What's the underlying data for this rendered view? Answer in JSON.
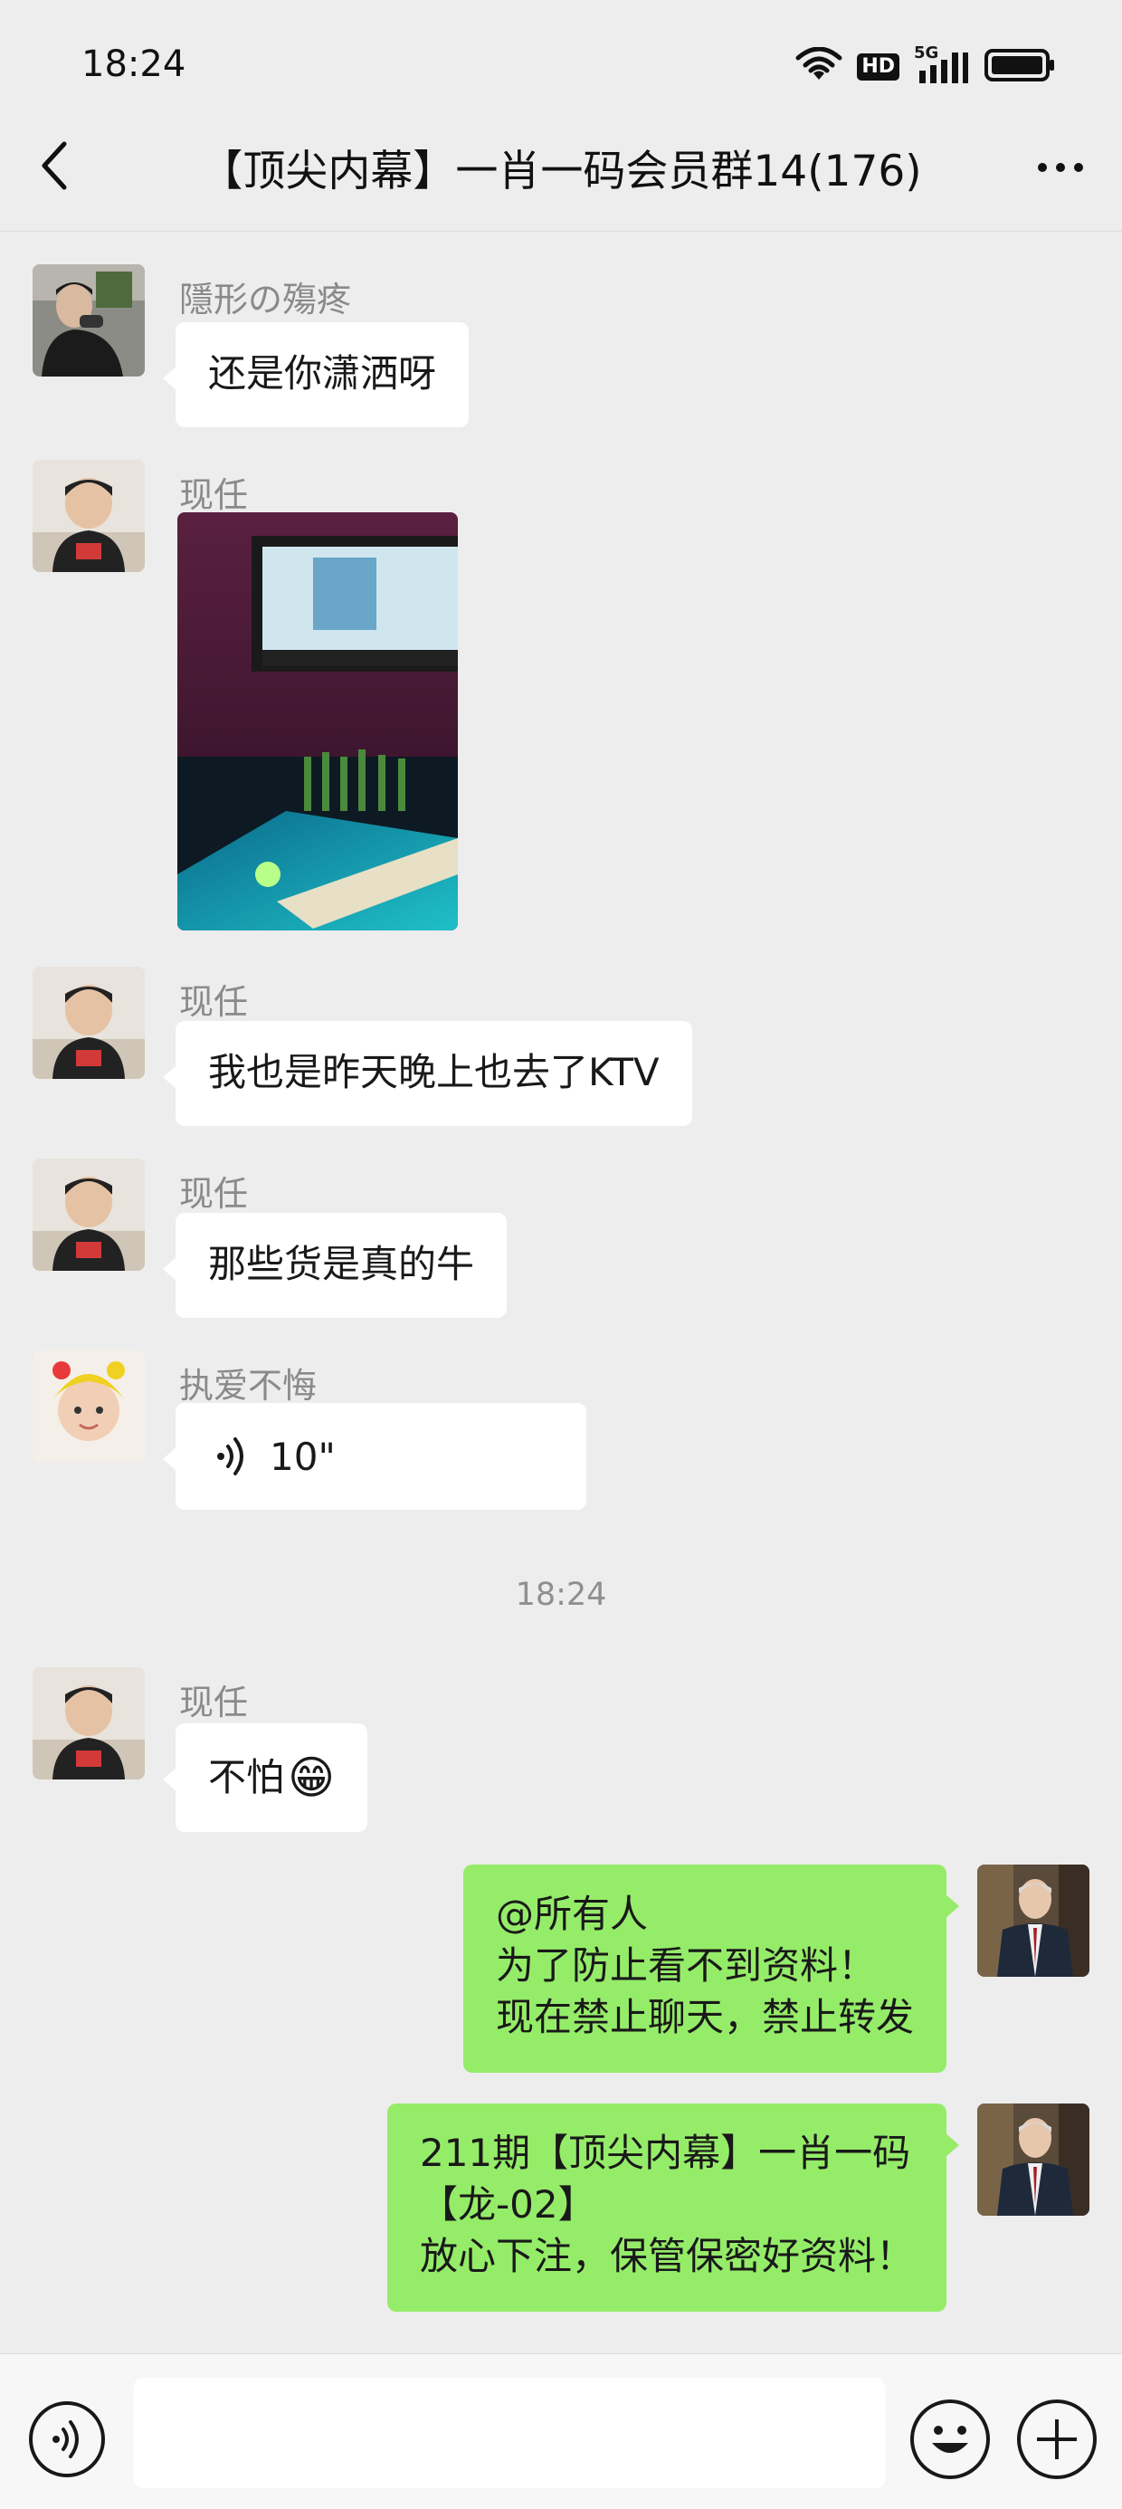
{
  "status_bar": {
    "time": "18:24",
    "icons": [
      "wifi-icon",
      "hd-icon",
      "5g-signal-icon",
      "battery-icon"
    ],
    "hd_label": "HD",
    "network_label": "5G"
  },
  "header": {
    "title": "【顶尖内幕】一肖一码会员群14(176)",
    "back_icon": "chevron-left-icon",
    "more_icon": "more-dots-icon"
  },
  "messages": [
    {
      "sender": "隱形の殤疼",
      "type": "text",
      "text": "还是你潇洒呀",
      "side": "left"
    },
    {
      "sender": "现任",
      "type": "image",
      "side": "left",
      "image_subject": "KTV room photo"
    },
    {
      "sender": "现任",
      "type": "text",
      "text": "我也是昨天晚上也去了KTV",
      "side": "left"
    },
    {
      "sender": "现任",
      "type": "text",
      "text": "那些货是真的牛",
      "side": "left"
    },
    {
      "sender": "执爱不悔",
      "type": "voice",
      "duration": "10\"",
      "side": "left"
    },
    {
      "sender": "现任",
      "type": "text",
      "text": "不怕",
      "emoji": "😁",
      "side": "left"
    },
    {
      "type": "text",
      "side": "right",
      "lines": [
        "@所有人",
        "为了防止看不到资料！",
        "现在禁止聊天，禁止转发"
      ]
    },
    {
      "type": "text",
      "side": "right",
      "lines": [
        "211期【顶尖内幕】一肖一码",
        "【龙-02】",
        "放心下注，保管保密好资料！"
      ]
    }
  ],
  "timestamp": "18:24",
  "input_bar": {
    "placeholder": "",
    "icons": [
      "voice-toggle-icon",
      "emoji-icon",
      "plus-icon"
    ]
  },
  "colors": {
    "background": "#ededed",
    "incoming_bubble": "#ffffff",
    "outgoing_bubble": "#95ec69",
    "sender_name": "#8a8a8a"
  }
}
